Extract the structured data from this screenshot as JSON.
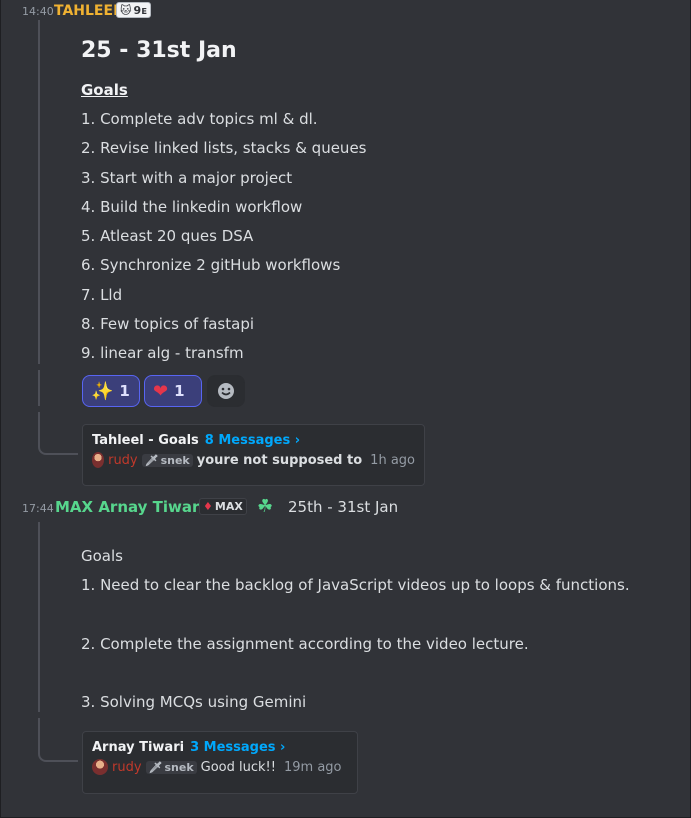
{
  "message1": {
    "time": "14:40",
    "username": "TAHLEEL",
    "tag": "9ᴇ",
    "heading": "25 - 31st Jan",
    "goals_heading": "Goals",
    "goals": [
      "1. Complete adv topics ml & dl.",
      "2. Revise linked lists, stacks & queues",
      "3. Start with a major project",
      "4. Build the linkedin workflow",
      "5. Atleast 20 ques DSA",
      "6. Synchronize 2 gitHub workflows",
      "7. Lld",
      "8. Few topics of fastapi",
      "9. linear alg - transfm"
    ],
    "reactions": [
      {
        "emoji": "✨",
        "count": "1"
      },
      {
        "emoji": "❤",
        "count": "1"
      }
    ],
    "thread": {
      "title": "Tahleel - Goals",
      "count": "8 Messages ›",
      "author": "rudy",
      "author_tag": "snek",
      "preview": "youre not supposed to",
      "ago": "1h ago"
    }
  },
  "message2": {
    "time": "17:44",
    "username": "MAX Arnay Tiwari",
    "tag": "MAX",
    "inline_text": "25th - 31st Jan",
    "lines": [
      "Goals",
      "1. Need to clear the backlog of JavaScript videos up to loops & functions.",
      "2. Complete the assignment according to the video lecture.",
      "3. Solving MCQs using Gemini"
    ],
    "thread": {
      "title": "Arnay Tiwari",
      "count": "3 Messages ›",
      "author": "rudy",
      "author_tag": "snek",
      "preview": "Good luck!!",
      "ago": "19m ago"
    }
  },
  "colors": {
    "background": "#313338",
    "tahleel": "#f0b232",
    "arnay": "#57d68d",
    "link": "#00a8fc",
    "rudy": "#c0392b"
  }
}
